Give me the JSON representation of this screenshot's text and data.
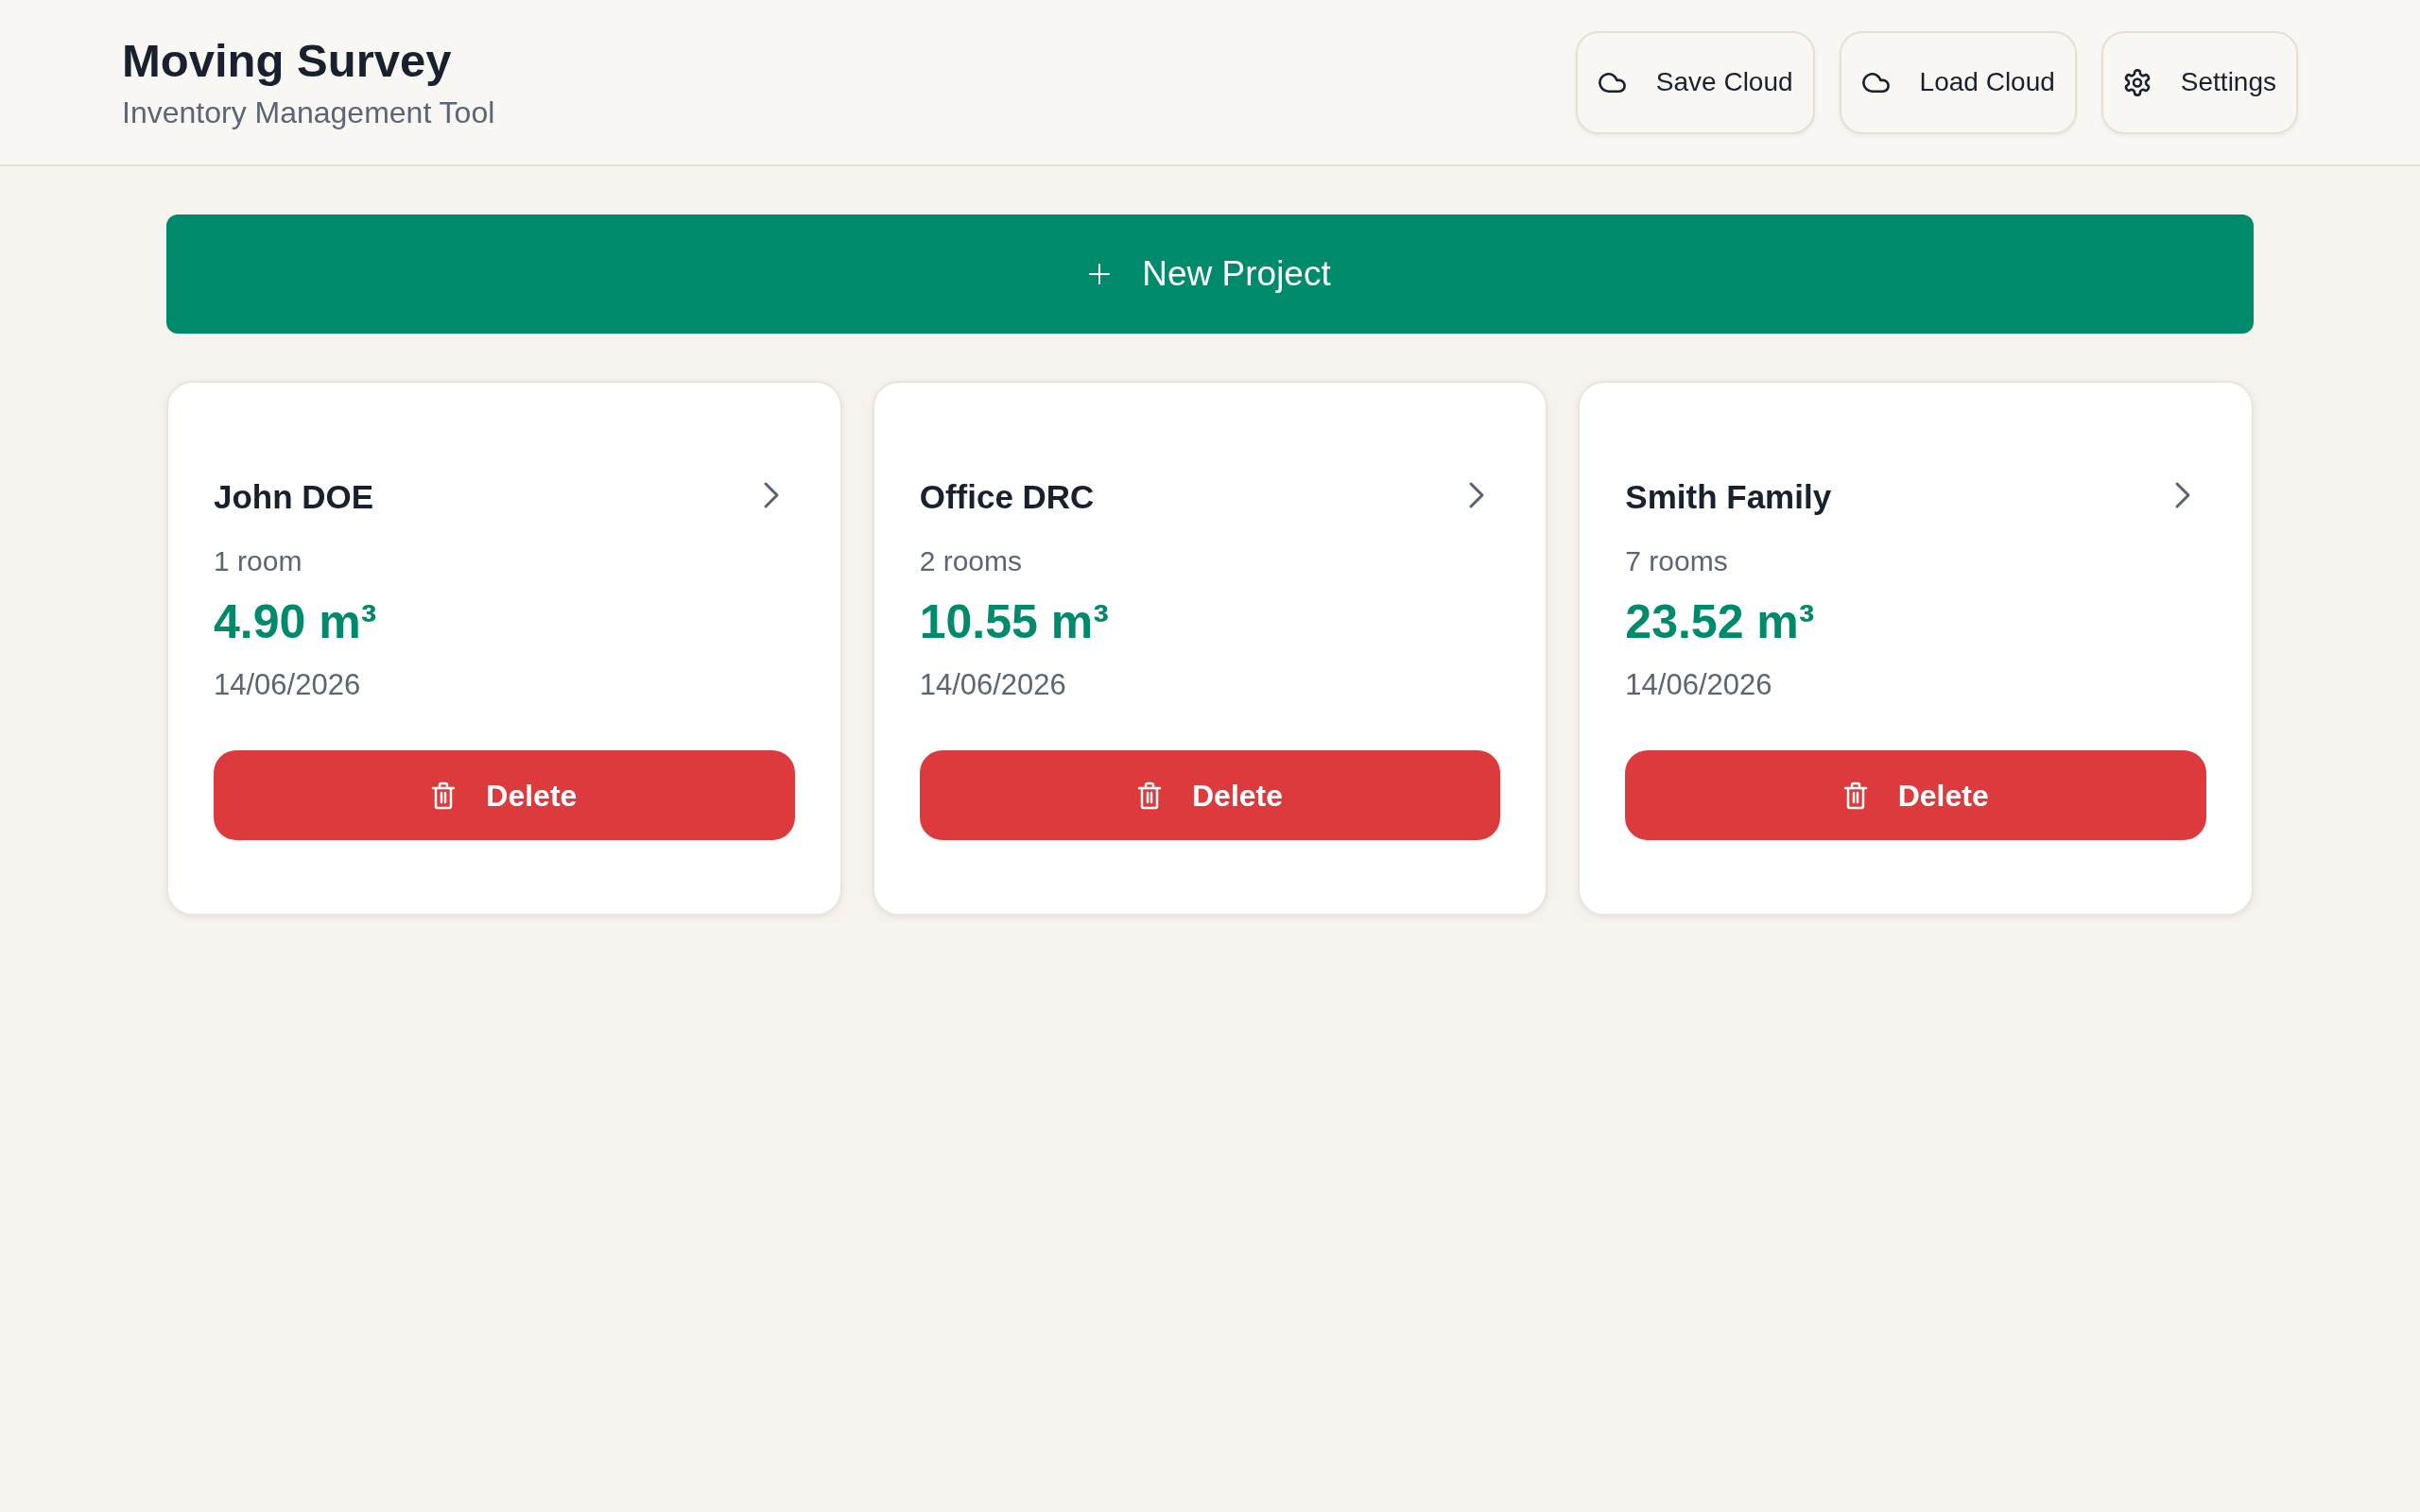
{
  "header": {
    "title": "Moving Survey",
    "subtitle": "Inventory Management Tool",
    "actions": [
      {
        "label": "Save Cloud",
        "kind": "cloud"
      },
      {
        "label": "Load Cloud",
        "kind": "cloud"
      },
      {
        "label": "Settings",
        "kind": "settings"
      }
    ]
  },
  "new_project_button": {
    "label": "New Project"
  },
  "projects": [
    {
      "name": "John DOE",
      "rooms": "1 room",
      "volume": "4.90 m³",
      "date": "14/06/2026",
      "delete_label": "Delete"
    },
    {
      "name": "Office DRC",
      "rooms": "2 rooms",
      "volume": "10.55 m³",
      "date": "14/06/2026",
      "delete_label": "Delete"
    },
    {
      "name": "Smith Family",
      "rooms": "7 rooms",
      "volume": "23.52 m³",
      "date": "14/06/2026",
      "delete_label": "Delete"
    }
  ]
}
